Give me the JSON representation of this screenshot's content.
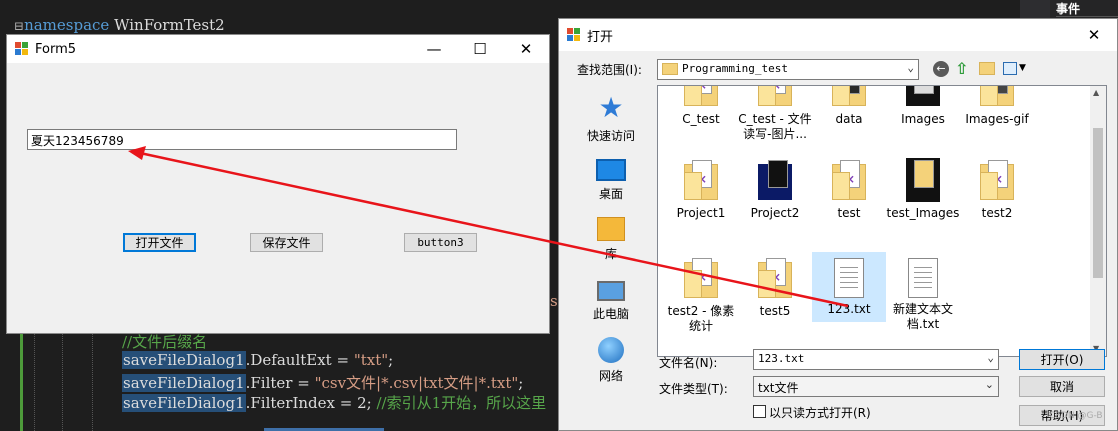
{
  "editor": {
    "line0_kw": "namespace",
    "line0_name": "WinFormTest2",
    "comment1": "//文件后缀名",
    "l1_obj": "saveFileDialog1",
    "l1_rest": ".DefaultExt = ",
    "l1_str": "\"txt\"",
    "l1_end": ";",
    "l2_obj": "saveFileDialog1",
    "l2_rest": ".Filter = ",
    "l2_str": "\"csv文件|*.csv|txt文件|*.txt\"",
    "l2_end": ";",
    "l3_obj": "saveFileDialog1",
    "l3_rest": ".FilterIndex = 2; ",
    "l3_cmt": "//索引从1开始，所以这里",
    "side_letter": "s",
    "right_panel": "事件"
  },
  "form5": {
    "title": "Form5",
    "minimize": "—",
    "maximize": "☐",
    "close": "✕",
    "textbox_value": "夏天123456789",
    "btn_open": "打开文件",
    "btn_save": "保存文件",
    "btn3": "button3"
  },
  "dialog": {
    "title": "打开",
    "close": "✕",
    "lookin_label": "查找范围(I):",
    "lookin_value": "Programming_test",
    "places": [
      {
        "label": "快速访问",
        "icon": "star-icon"
      },
      {
        "label": "桌面",
        "icon": "desktop-icon"
      },
      {
        "label": "库",
        "icon": "library-icon"
      },
      {
        "label": "此电脑",
        "icon": "computer-icon"
      },
      {
        "label": "网络",
        "icon": "network-icon"
      }
    ],
    "files_row1": [
      "C_test",
      "C_test - 文件读写-图片...",
      "data",
      "Images",
      "Images-gif"
    ],
    "files_row2": [
      "Project1",
      "Project2",
      "test",
      "test_Images",
      "test2"
    ],
    "files_row3": [
      "test2 - 像素统计",
      "test5",
      "123.txt",
      "新建文本文档.txt"
    ],
    "filename_label": "文件名(N):",
    "filename_value": "123.txt",
    "filetype_label": "文件类型(T):",
    "filetype_value": "txt文件",
    "readonly_label": "以只读方式打开(R)",
    "btn_open": "打开(O)",
    "btn_cancel": "取消",
    "btn_help": "帮助(H)",
    "watermark": "CSDN @G-B"
  },
  "colors": {
    "arrow": "#e8141a",
    "selection": "#cce8ff",
    "accent": "#0078d7"
  }
}
